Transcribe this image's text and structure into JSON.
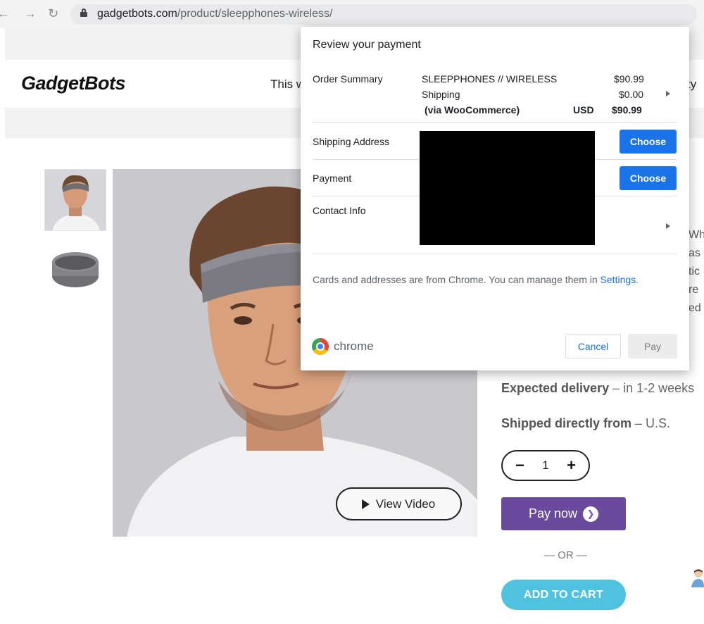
{
  "browser": {
    "url_domain": "gadgetbots.com",
    "url_path": "/product/sleepphones-wireless/",
    "nav_icons": [
      "back-icon",
      "forward-icon",
      "reload-icon",
      "lock-icon"
    ]
  },
  "site": {
    "logo": "GadgetBots",
    "header_text": "This w",
    "header_text_right": "ty"
  },
  "product": {
    "view_video": "View Video",
    "delivery_label": "Expected delivery",
    "delivery_value": " – in 1-2 weeks",
    "shipped_label": "Shipped directly from",
    "shipped_value": " – U.S.",
    "qty_minus": "−",
    "qty_value": "1",
    "qty_plus": "+",
    "pay_now": "Pay now",
    "or": "— OR —",
    "add_to_cart": "ADD TO CART",
    "peek_lines": [
      "Wh",
      "as",
      "tic",
      "re",
      "ed"
    ],
    "colors": {
      "pay_now": "#6a4a9c",
      "add_to_cart": "#4fc2df"
    }
  },
  "dialog": {
    "title": "Review your payment",
    "order_summary_label": "Order Summary",
    "item_name": "SLEEPPHONES // WIRELESS",
    "item_price": "$90.99",
    "shipping_name": "Shipping",
    "shipping_price": "$0.00",
    "via": "(via WooCommerce)",
    "currency": "USD",
    "total": "$90.99",
    "shipping_address_label": "Shipping Address",
    "payment_label": "Payment",
    "contact_info_label": "Contact Info",
    "choose_label": "Choose",
    "info_text": "Cards and addresses are from Chrome. You can manage them in ",
    "settings_link": "Settings",
    "info_end": ".",
    "brand": "chrome",
    "cancel": "Cancel",
    "pay": "Pay",
    "accent": "#1a73e8"
  }
}
